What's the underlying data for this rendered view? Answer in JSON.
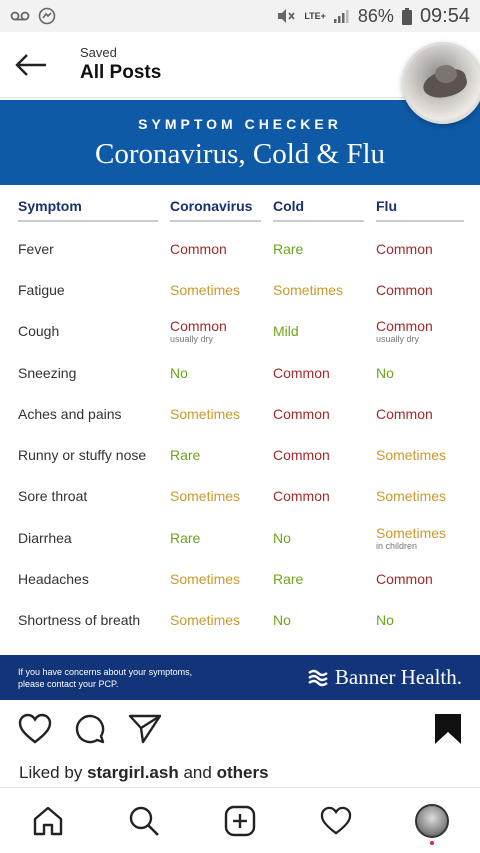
{
  "status_bar": {
    "battery": "86%",
    "time": "09:54",
    "network": "LTE+"
  },
  "header": {
    "subtitle": "Saved",
    "title": "All Posts"
  },
  "post": {
    "banner_small": "SYMPTOM CHECKER",
    "banner_title": "Coronavirus, Cold & Flu",
    "columns": [
      "Symptom",
      "Coronavirus",
      "Cold",
      "Flu"
    ],
    "rows": [
      {
        "symptom": "Fever",
        "corona": "Common",
        "corona_note": "",
        "cold": "Rare",
        "flu": "Common",
        "flu_note": ""
      },
      {
        "symptom": "Fatigue",
        "corona": "Sometimes",
        "corona_note": "",
        "cold": "Sometimes",
        "flu": "Common",
        "flu_note": ""
      },
      {
        "symptom": "Cough",
        "corona": "Common",
        "corona_note": "usually dry",
        "cold": "Mild",
        "flu": "Common",
        "flu_note": "usually dry"
      },
      {
        "symptom": "Sneezing",
        "corona": "No",
        "corona_note": "",
        "cold": "Common",
        "flu": "No",
        "flu_note": ""
      },
      {
        "symptom": "Aches and pains",
        "corona": "Sometimes",
        "corona_note": "",
        "cold": "Common",
        "flu": "Common",
        "flu_note": ""
      },
      {
        "symptom": "Runny or stuffy nose",
        "corona": "Rare",
        "corona_note": "",
        "cold": "Common",
        "flu": "Sometimes",
        "flu_note": ""
      },
      {
        "symptom": "Sore throat",
        "corona": "Sometimes",
        "corona_note": "",
        "cold": "Common",
        "flu": "Sometimes",
        "flu_note": ""
      },
      {
        "symptom": "Diarrhea",
        "corona": "Rare",
        "corona_note": "",
        "cold": "No",
        "flu": "Sometimes",
        "flu_note": "in children"
      },
      {
        "symptom": "Headaches",
        "corona": "Sometimes",
        "corona_note": "",
        "cold": "Rare",
        "flu": "Common",
        "flu_note": ""
      },
      {
        "symptom": "Shortness of breath",
        "corona": "Sometimes",
        "corona_note": "",
        "cold": "No",
        "flu": "No",
        "flu_note": ""
      }
    ],
    "footer_note_line1": "If you have concerns about your symptoms,",
    "footer_note_line2": "please contact your PCP.",
    "brand": "Banner Health."
  },
  "likes": {
    "prefix": "Liked by",
    "user": "stargirl.ash",
    "middle": "and",
    "others": "others"
  },
  "colors": {
    "banner_blue": "#0e5aa7",
    "footer_navy": "#12357a",
    "common_red": "#a42a2a",
    "rare_green": "#6fa41e",
    "sometimes_gold": "#c99a2e"
  },
  "nav": [
    "home-icon",
    "search-icon",
    "add-post-icon",
    "activity-heart-icon",
    "profile-avatar"
  ]
}
